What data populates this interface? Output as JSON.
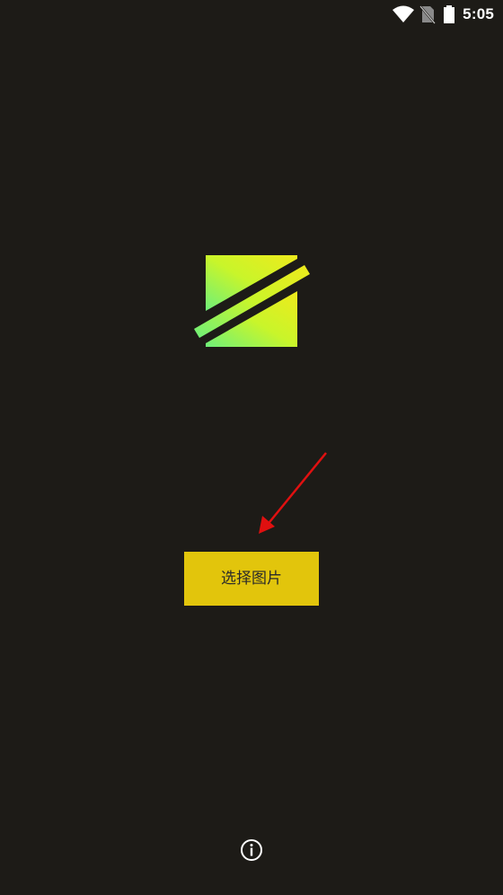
{
  "status_bar": {
    "time": "5:05",
    "icons": [
      "wifi-icon",
      "no-sim-icon",
      "battery-icon"
    ]
  },
  "app": {
    "logo": "app-logo",
    "select_button_label": "选择图片",
    "info_icon": "info-icon"
  },
  "colors": {
    "background": "#1d1b17",
    "accent": "#e2c50c",
    "logo_gradient_start": "#6ef07a",
    "logo_gradient_end": "#eeea1c",
    "annotation_arrow": "#e01010"
  }
}
